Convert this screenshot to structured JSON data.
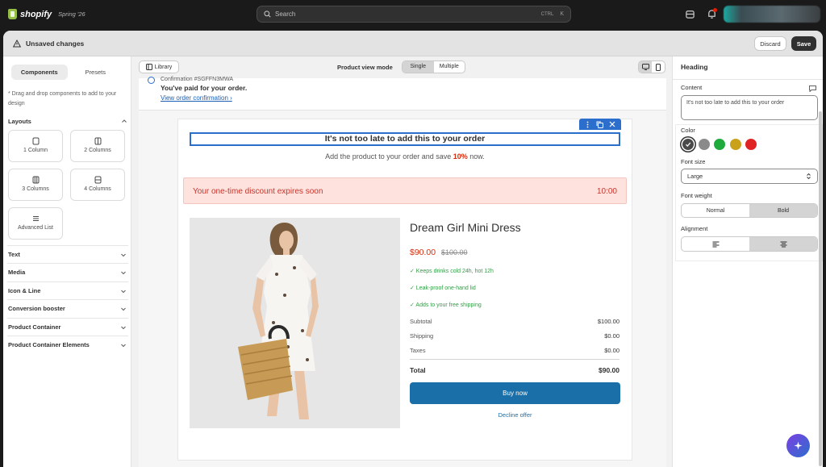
{
  "topbar": {
    "brand": "shopify",
    "edition": "Spring '26",
    "search_placeholder": "Search",
    "shortcut_ctrl": "CTRL",
    "shortcut_key": "K"
  },
  "savebar": {
    "status": "Unsaved changes",
    "discard_label": "Discard",
    "save_label": "Save"
  },
  "left": {
    "tabs": [
      "Components",
      "Presets"
    ],
    "active_tab": "Components",
    "hint": "* Drag and drop components to add to your design",
    "layouts_title": "Layouts",
    "layouts": [
      "1 Column",
      "2 Columns",
      "3 Columns",
      "4 Columns",
      "Advanced List"
    ],
    "sections": [
      "Text",
      "Media",
      "Icon & Line",
      "Conversion booster",
      "Product Container",
      "Product Container Elements"
    ]
  },
  "toolbar": {
    "library_label": "Library",
    "view_mode_label": "Product view mode",
    "view_modes": [
      "Single",
      "Multiple"
    ],
    "active_view_mode": "Single"
  },
  "confirmation": {
    "label": "Confirmation #SGFFN3MWA",
    "title": "You've paid for your order.",
    "link": "View order confirmation ›"
  },
  "offer": {
    "heading": "It's not too late to add this to your order",
    "sub_before": "Add the product to your order and save ",
    "sub_pct": "10%",
    "sub_after": " now.",
    "discount_text": "Your one-time discount expires soon",
    "discount_time": "10:00",
    "product_name": "Dream Girl Mini Dress",
    "price": "$90.00",
    "old_price": "$100.00",
    "features": [
      "✓ Keeps drinks cold 24h, hot 12h",
      "✓ Leak-proof one-hand lid",
      "✓ Adds to your free shipping"
    ],
    "summary": [
      {
        "label": "Subtotal",
        "value": "$100.00"
      },
      {
        "label": "Shipping",
        "value": "$0.00"
      },
      {
        "label": "Taxes",
        "value": "$0.00"
      }
    ],
    "total_label": "Total",
    "total_value": "$90.00",
    "buy_label": "Buy now",
    "decline_label": "Decline offer"
  },
  "panel": {
    "title": "Heading",
    "content_label": "Content",
    "content_value": "It's not too late to add this to your order",
    "color_label": "Color",
    "colors": [
      "#4a4a4a",
      "#8a8a8a",
      "#1faa3c",
      "#c9a11a",
      "#e02424"
    ],
    "selected_color": "#4a4a4a",
    "font_size_label": "Font size",
    "font_size_value": "Large",
    "font_weight_label": "Font weight",
    "font_weights": [
      "Normal",
      "Bold"
    ],
    "selected_font_weight": "Bold",
    "alignment_label": "Alignment",
    "selected_alignment": "center"
  }
}
